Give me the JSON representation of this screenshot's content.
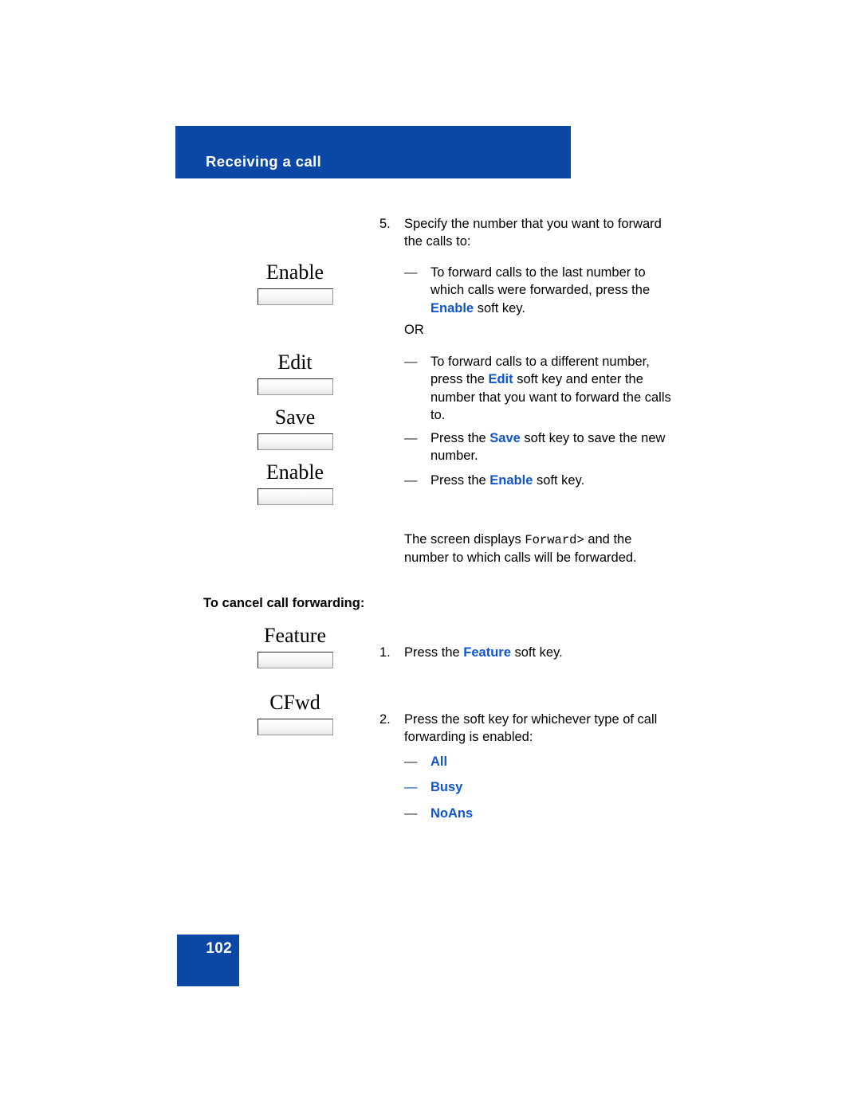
{
  "page": {
    "header_title": "Receiving a call",
    "page_number": "102",
    "accent_blue": "#0B47A5",
    "link_blue": "#1155CC"
  },
  "softkeys": [
    {
      "label": "Enable",
      "name": "enable"
    },
    {
      "label": "Edit",
      "name": "edit"
    },
    {
      "label": "Save",
      "name": "save"
    },
    {
      "label": "Enable",
      "name": "enable-2"
    },
    {
      "label": "Feature",
      "name": "feature"
    },
    {
      "label": "CFwd",
      "name": "cfwd"
    }
  ],
  "instructions": {
    "step5": {
      "number": "5.",
      "text": "Specify the number that you want to forward the calls to:",
      "bullets": [
        {
          "dash": "—",
          "pre": "To forward calls to the last number to which calls were forwarded, press the ",
          "keyword": "Enable",
          "post": " soft key."
        }
      ],
      "or_label": "OR",
      "bullets2": [
        {
          "dash": "—",
          "pre": "To forward calls to a different number, press the ",
          "keyword": "Edit",
          "post": " soft key and enter the number that you want to forward the calls to."
        },
        {
          "dash": "—",
          "pre": "Press the ",
          "keyword": "Save",
          "post": " soft key to save the new number."
        },
        {
          "dash": "—",
          "pre": "Press the ",
          "keyword": "Enable",
          "post": " soft key."
        }
      ]
    },
    "screen_note": {
      "pre": "The screen displays ",
      "mono": "Forward>",
      "post": " and the number to which calls will be forwarded."
    },
    "cancel_heading": "To cancel call forwarding:",
    "step1": {
      "number": "1.",
      "pre": "Press the ",
      "keyword": "Feature",
      "post": " soft key."
    },
    "step2": {
      "number": "2.",
      "text": "Press the soft key for whichever type of call forwarding is enabled:",
      "options": [
        {
          "dash": "—",
          "label": "All",
          "dash_color": "dark"
        },
        {
          "dash": "—",
          "label": "Busy",
          "dash_color": "blue"
        },
        {
          "dash": "—",
          "label": "NoAns",
          "dash_color": "dark"
        }
      ]
    }
  }
}
